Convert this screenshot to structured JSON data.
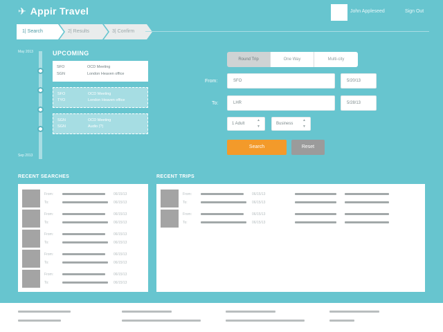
{
  "header": {
    "logo_icon": "plane-icon",
    "app_name": "Appir Travel",
    "user_name": "John Appleseed",
    "signout_label": "Sign Out"
  },
  "wizard": {
    "steps": [
      {
        "label": "1| Search",
        "active": true
      },
      {
        "label": "2| Results",
        "active": false
      },
      {
        "label": "3| Confirm",
        "active": false
      }
    ]
  },
  "upcoming": {
    "title": "UPCOMING",
    "start_date": "May 2013",
    "end_date": "Sep 2013",
    "trips": [
      {
        "code_from": "SFO",
        "code_to": "SGN",
        "title": "OCD Meeting",
        "place": "London Heaven office",
        "style": "solid"
      },
      {
        "code_from": "SFO",
        "code_to": "TYO",
        "title": "OCD Meeting",
        "place": "London Heaven office",
        "style": "ghost"
      },
      {
        "code_from": "SGN",
        "code_to": "SGN",
        "title": "OCD Meeting",
        "place": "Audio (?)",
        "style": "ghost"
      }
    ]
  },
  "search_form": {
    "trip_types": [
      "Round Trip",
      "One Way",
      "Multi-city"
    ],
    "active_trip_type": "Round Trip",
    "from_label": "From:",
    "from_value": "SFO",
    "from_date": "5/20/13",
    "to_label": "To:",
    "to_value": "LHR",
    "to_date": "5/28/13",
    "passengers": "1 Adult",
    "cabin": "Business",
    "search_label": "Search",
    "reset_label": "Reset"
  },
  "recent_searches": {
    "title": "RECENT SEARCHES",
    "from_label": "From:",
    "to_label": "To:",
    "date": "06/15/13",
    "count": 5
  },
  "recent_trips": {
    "title": "RECENT TRIPS",
    "from_label": "From:",
    "to_label": "To:",
    "date": "06/15/13",
    "count": 2
  },
  "colors": {
    "teal": "#67c5cf",
    "accent_orange": "#f39a2a",
    "reset_gray": "#9b9b9b"
  }
}
